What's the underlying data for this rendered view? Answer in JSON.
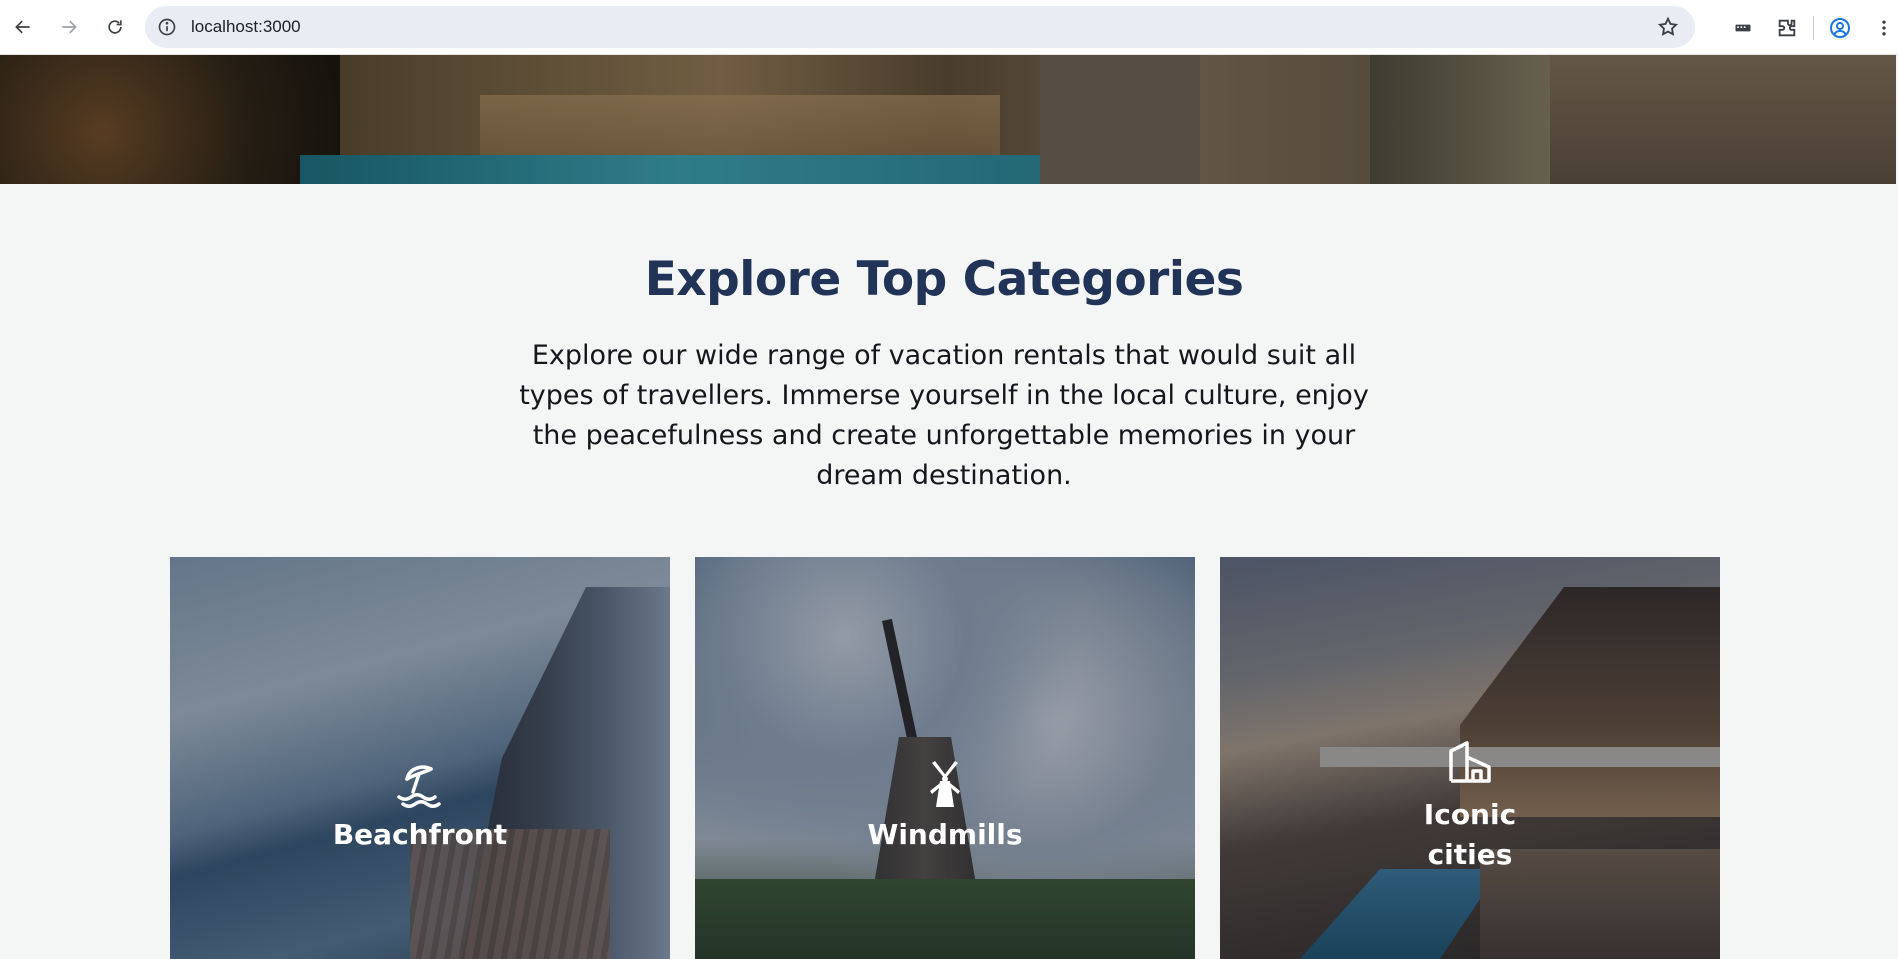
{
  "browser": {
    "url": "localhost:3000"
  },
  "section": {
    "title": "Explore Top Categories",
    "description": "Explore our wide range of vacation rentals that would suit all types of travellers. Immerse yourself in the local culture, enjoy the peacefulness and create unforgettable memories in your dream destination."
  },
  "categories": [
    {
      "label": "Beachfront",
      "icon": "beach-umbrella-icon"
    },
    {
      "label": "Windmills",
      "icon": "windmill-icon"
    },
    {
      "label": "Iconic cities",
      "icon": "city-building-icon"
    }
  ]
}
